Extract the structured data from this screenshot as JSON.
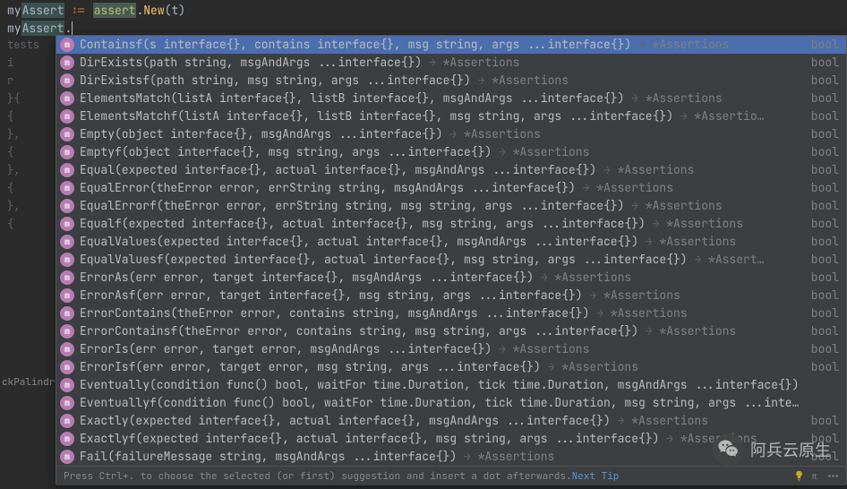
{
  "code": {
    "line1_prefix": "my",
    "line1_highlight": "Assert",
    "line1_op": " := ",
    "line1_package": "assert",
    "line1_dot": ".",
    "line1_func": "New",
    "line1_paren_open": "(",
    "line1_param": "t",
    "line1_paren_close": ")",
    "line2_prefix": "my",
    "line2_highlight": "Assert",
    "line2_dot": "."
  },
  "gutter": [
    "tests",
    "    i",
    "    r",
    "",
    "}{",
    "    {",
    "",
    "",
    "    },",
    "    {",
    "",
    "",
    "    },",
    "    {",
    "",
    "",
    "    },",
    "    {"
  ],
  "sidebar_label": "ckPalindro",
  "completions": [
    {
      "sig": "Containsf(s interface{}, contains interface{}, msg string, args ...interface{})",
      "ret": "*Assertions",
      "type": "bool"
    },
    {
      "sig": "DirExists(path string, msgAndArgs ...interface{})",
      "ret": "*Assertions",
      "type": "bool"
    },
    {
      "sig": "DirExistsf(path string, msg string, args ...interface{})",
      "ret": "*Assertions",
      "type": "bool"
    },
    {
      "sig": "ElementsMatch(listA interface{}, listB interface{}, msgAndArgs ...interface{})",
      "ret": "*Assertions",
      "type": "bool"
    },
    {
      "sig": "ElementsMatchf(listA interface{}, listB interface{}, msg string, args ...interface{})",
      "ret": "*Assertio…",
      "type": "bool"
    },
    {
      "sig": "Empty(object interface{}, msgAndArgs ...interface{})",
      "ret": "*Assertions",
      "type": "bool"
    },
    {
      "sig": "Emptyf(object interface{}, msg string, args ...interface{})",
      "ret": "*Assertions",
      "type": "bool"
    },
    {
      "sig": "Equal(expected interface{}, actual interface{}, msgAndArgs ...interface{})",
      "ret": "*Assertions",
      "type": "bool"
    },
    {
      "sig": "EqualError(theError error, errString string, msgAndArgs ...interface{})",
      "ret": "*Assertions",
      "type": "bool"
    },
    {
      "sig": "EqualErrorf(theError error, errString string, msg string, args ...interface{})",
      "ret": "*Assertions",
      "type": "bool"
    },
    {
      "sig": "Equalf(expected interface{}, actual interface{}, msg string, args ...interface{})",
      "ret": "*Assertions",
      "type": "bool"
    },
    {
      "sig": "EqualValues(expected interface{}, actual interface{}, msgAndArgs ...interface{})",
      "ret": "*Assertions",
      "type": "bool"
    },
    {
      "sig": "EqualValuesf(expected interface{}, actual interface{}, msg string, args ...interface{})",
      "ret": "*Assert…",
      "type": "bool"
    },
    {
      "sig": "ErrorAs(err error, target interface{}, msgAndArgs ...interface{})",
      "ret": "*Assertions",
      "type": "bool"
    },
    {
      "sig": "ErrorAsf(err error, target interface{}, msg string, args ...interface{})",
      "ret": "*Assertions",
      "type": "bool"
    },
    {
      "sig": "ErrorContains(theError error, contains string, msgAndArgs ...interface{})",
      "ret": "*Assertions",
      "type": "bool"
    },
    {
      "sig": "ErrorContainsf(theError error, contains string, msg string, args ...interface{})",
      "ret": "*Assertions",
      "type": "bool"
    },
    {
      "sig": "ErrorIs(err error, target error, msgAndArgs ...interface{})",
      "ret": "*Assertions",
      "type": "bool"
    },
    {
      "sig": "ErrorIsf(err error, target error, msg string, args ...interface{})",
      "ret": "*Assertions",
      "type": "bool"
    },
    {
      "sig": "Eventually(condition func() bool, waitFor time.Duration, tick time.Duration, msgAndArgs ...interface{})",
      "ret": "",
      "type": ""
    },
    {
      "sig": "Eventuallyf(condition func() bool, waitFor time.Duration, tick time.Duration, msg string, args ...inte…",
      "ret": "",
      "type": ""
    },
    {
      "sig": "Exactly(expected interface{}, actual interface{}, msgAndArgs ...interface{})",
      "ret": "*Assertions",
      "type": "bool"
    },
    {
      "sig": "Exactlyf(expected interface{}, actual interface{}, msg string, args ...interface{})",
      "ret": "*Assertions",
      "type": "bool"
    },
    {
      "sig": "Fail(failureMessage string, msgAndArgs ...interface{})",
      "ret": "*Assertions",
      "type": "bool"
    }
  ],
  "footer": {
    "hint": "Press Ctrl+. to choose the selected (or first) suggestion and insert a dot afterwards. ",
    "link": "Next Tip"
  },
  "watermark_text": "阿兵云原生"
}
